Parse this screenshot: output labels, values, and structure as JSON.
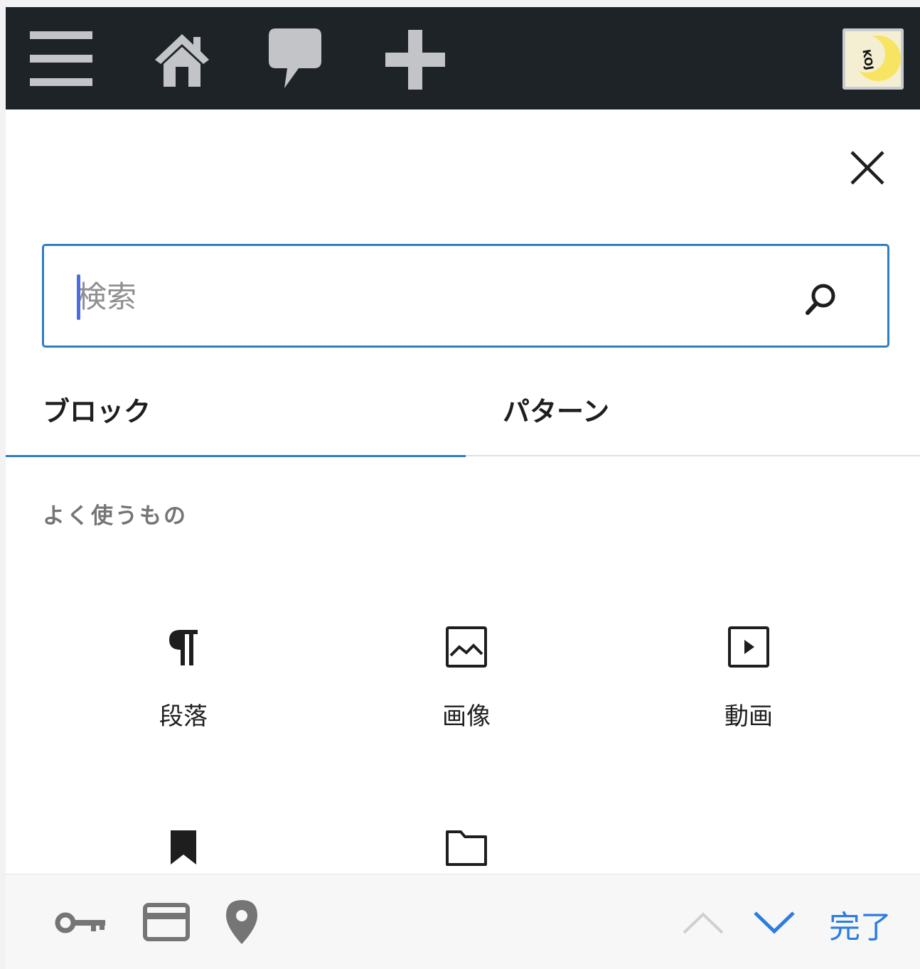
{
  "adminbar": {
    "icons": [
      "menu-icon",
      "home-icon",
      "comment-icon",
      "plus-icon"
    ],
    "avatar_text": "KOJ"
  },
  "inserter": {
    "close_icon": "close-icon",
    "search": {
      "placeholder": "検索",
      "value": "",
      "icon": "search-icon"
    },
    "tabs": [
      {
        "label": "ブロック",
        "active": true
      },
      {
        "label": "パターン",
        "active": false
      }
    ],
    "section_title": "よく使うもの",
    "blocks": [
      {
        "label": "段落",
        "icon": "paragraph-icon"
      },
      {
        "label": "画像",
        "icon": "image-icon"
      },
      {
        "label": "動画",
        "icon": "video-icon"
      },
      {
        "label": "",
        "icon": "bookmark-icon"
      },
      {
        "label": "",
        "icon": "folder-icon"
      }
    ]
  },
  "keyboard_toolbar": {
    "icons": [
      "key-icon",
      "credit-card-icon",
      "location-pin-icon",
      "chevron-up-icon",
      "chevron-down-icon"
    ],
    "done_label": "完了"
  },
  "colors": {
    "adminbar_bg": "#1e2327",
    "adminbar_icon": "#bfbfbf",
    "accent": "#2e7ec4",
    "done": "#2b7de0"
  }
}
